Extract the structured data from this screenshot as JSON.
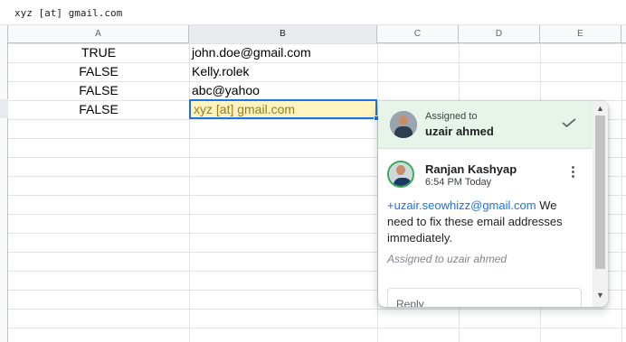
{
  "formula_bar": {
    "value": "xyz [at] gmail.com"
  },
  "columns": [
    "A",
    "B",
    "C",
    "D",
    "E"
  ],
  "rows": [
    {
      "a": "TRUE",
      "b": "john.doe@gmail.com"
    },
    {
      "a": "FALSE",
      "b": "Kelly.rolek"
    },
    {
      "a": "FALSE",
      "b": "abc@yahoo"
    },
    {
      "a": "FALSE",
      "b": "xyz [at] gmail.com"
    }
  ],
  "comment": {
    "assigned_label": "Assigned to",
    "assignee": "uzair ahmed",
    "author": "Ranjan Kashyap",
    "time": "6:54 PM Today",
    "mention": "+uzair.seowhizz@gmail.com",
    "text": " We need to fix these email addresses immediately.",
    "assigned_note": "Assigned to uzair ahmed",
    "reply_placeholder": "Reply"
  },
  "colors": {
    "accent": "#1a73e8",
    "assign_bg": "#e6f4ea",
    "active_fill": "#fff4c0"
  },
  "icons": [
    "check-icon",
    "more-vert-icon",
    "scroll-up-icon",
    "scroll-down-icon"
  ]
}
